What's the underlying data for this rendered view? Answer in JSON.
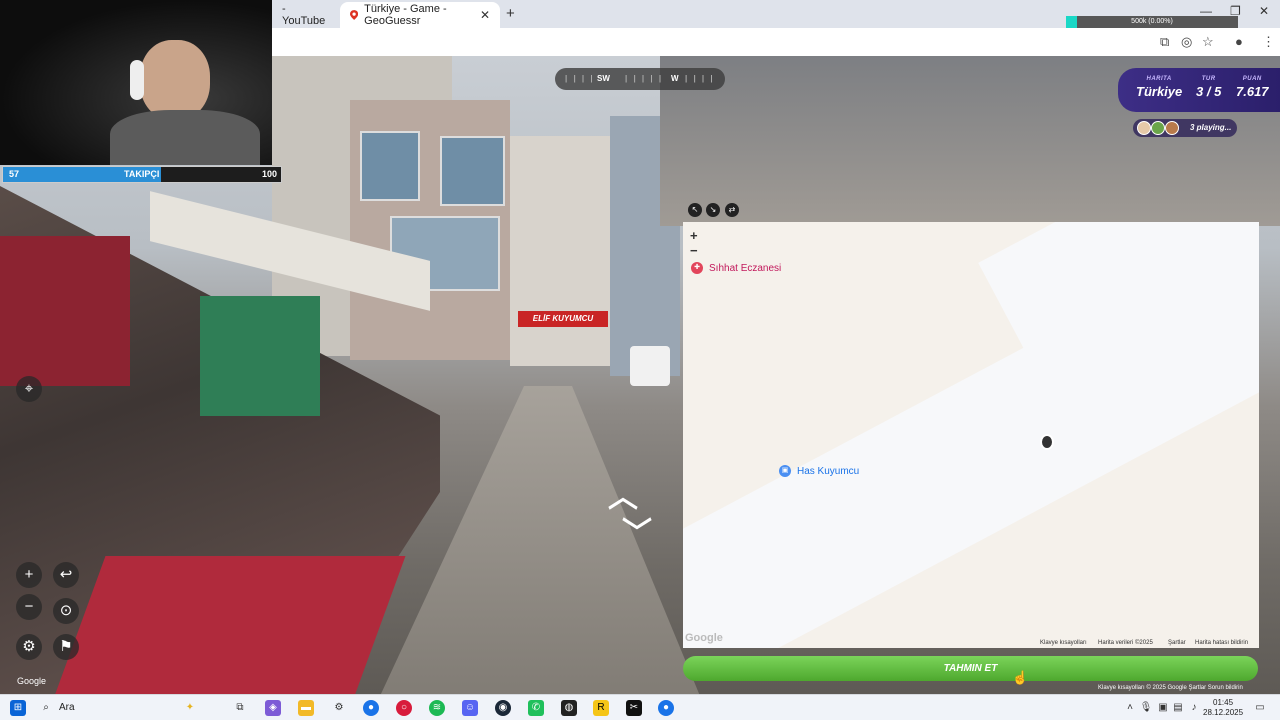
{
  "browser": {
    "tabs": [
      {
        "label": "- YouTube"
      },
      {
        "label": "Türkiye - Game - GeoGuessr"
      }
    ],
    "stats_text": "500k (0.00%)"
  },
  "compass": {
    "dir1": "SW",
    "dir2": "W"
  },
  "hud": {
    "map_label": "HARITA",
    "map_value": "Türkiye",
    "round_label": "TUR",
    "round_value": "3 / 5",
    "score_label": "PUAN",
    "score_value": "7.617",
    "playing": "3 playing..."
  },
  "followers": {
    "current": "57",
    "label": "TAKIPÇI",
    "goal": "100",
    "progress_fraction": 0.57
  },
  "controls": {
    "zoom_in": "+",
    "zoom_out": "−",
    "undo": "↩",
    "google": "Google"
  },
  "map": {
    "zoom_in": "+",
    "zoom_out": "−",
    "poi1": "Sıhhat Eczanesi",
    "poi2": "Has Kuyumcu",
    "logo": "Google",
    "footer": [
      "Klavye kısayolları",
      "Harita verileri ©2025",
      "Şartlar",
      "Harita hatası bildirin"
    ]
  },
  "guess_button": "TAHMIN ET",
  "street_credits": "Klavye kısayolları   © 2025 Google   Şartlar   Sorun bildirin",
  "taskbar": {
    "search": "Ara",
    "time": "01:45",
    "date": "28.12.2025"
  },
  "colors": {
    "hud_bg": "#3d2e86",
    "guess_green": "#5cb83a",
    "follower_blue": "#2a8fd6"
  }
}
